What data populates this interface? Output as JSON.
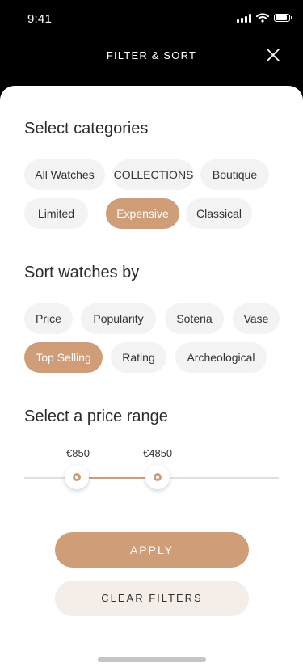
{
  "status": {
    "time": "9:41"
  },
  "header": {
    "title": "FILTER & SORT"
  },
  "categories": {
    "title": "Select categories",
    "items": [
      "All Watches",
      "COLLECTIONS",
      "Boutique",
      "Limited",
      "Expensive",
      "Classical"
    ],
    "selected": "Expensive"
  },
  "sort": {
    "title": "Sort watches by",
    "items": [
      "Price",
      "Popularity",
      "Soteria",
      "Vase",
      "Top Selling",
      "Rating",
      "Archeological"
    ],
    "selected": "Top Selling"
  },
  "price": {
    "title": "Select a price range",
    "min_label": "€850",
    "max_label": "€4850"
  },
  "actions": {
    "apply": "APPLY",
    "clear": "CLEAR FILTERS"
  },
  "colors": {
    "accent": "#cf9d77",
    "chip_bg": "#f3f3f3",
    "clear_bg": "#f5ede8"
  }
}
